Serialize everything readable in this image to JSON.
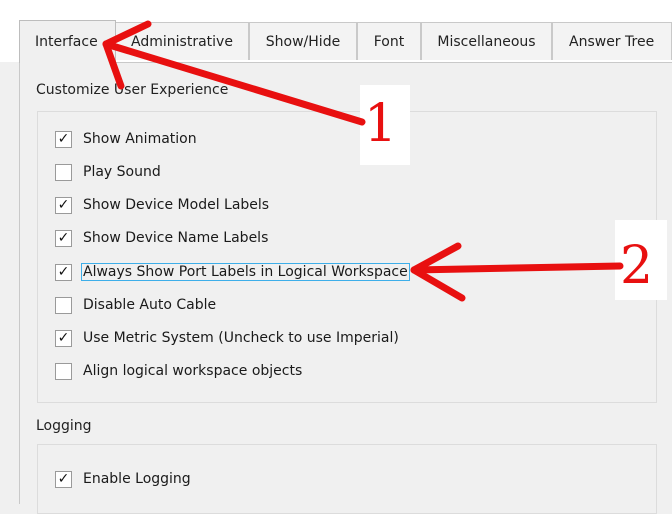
{
  "tabs": [
    {
      "label": "Interface",
      "active": true
    },
    {
      "label": "Administrative",
      "active": false
    },
    {
      "label": "Show/Hide",
      "active": false
    },
    {
      "label": "Font",
      "active": false
    },
    {
      "label": "Miscellaneous",
      "active": false
    },
    {
      "label": "Answer Tree",
      "active": false
    }
  ],
  "customize": {
    "title": "Customize User Experience",
    "options": [
      {
        "label": "Show Animation",
        "checked": true,
        "mark": "✓"
      },
      {
        "label": "Play Sound",
        "checked": false,
        "mark": ""
      },
      {
        "label": "Show Device Model Labels",
        "checked": true,
        "mark": "✓"
      },
      {
        "label": "Show Device Name Labels",
        "checked": true,
        "mark": "✓"
      },
      {
        "label": "Always Show Port Labels in Logical Workspace",
        "checked": true,
        "mark": "✓"
      },
      {
        "label": "Disable Auto Cable",
        "checked": false,
        "mark": ""
      },
      {
        "label": "Use Metric System (Uncheck to use Imperial)",
        "checked": true,
        "mark": "✓"
      },
      {
        "label": "Align logical workspace objects",
        "checked": false,
        "mark": ""
      }
    ]
  },
  "logging": {
    "title": "Logging",
    "options": [
      {
        "label": "Enable Logging",
        "checked": true,
        "mark": "✓"
      }
    ]
  },
  "annotations": {
    "marker1": "1",
    "marker2": "2",
    "color": "#e81010"
  }
}
